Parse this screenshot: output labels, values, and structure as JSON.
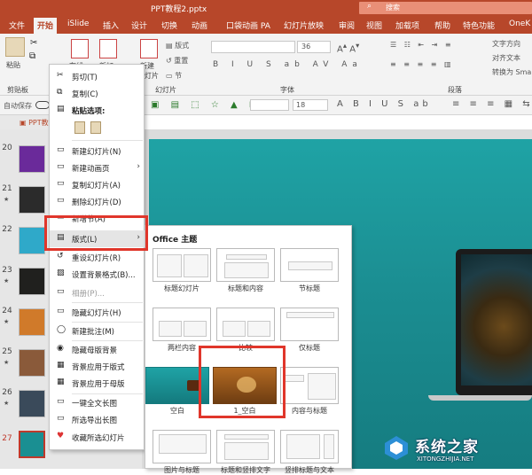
{
  "window": {
    "title": "PPT教程2.pptx",
    "search_placeholder": "搜索"
  },
  "tabs": [
    "开始",
    "iSlide",
    "插入",
    "设计",
    "切换",
    "动画",
    "口袋动画 PA",
    "幻灯片放映",
    "审阅",
    "视图",
    "加载项",
    "帮助",
    "特色功能",
    "OneK"
  ],
  "active_tab": "开始",
  "ribbon": {
    "paste": "粘贴",
    "new_slide_partial": "在线",
    "new_partial": "新加",
    "new_slide": "新建",
    "new_slide2": "幻灯片",
    "layout_btn": "版式",
    "reset_btn": "重置",
    "section_btn": "节",
    "clipboard_group": "剪贴板",
    "slides_group": "幻灯片",
    "font_group": "字体",
    "paragraph_group": "段落",
    "font_size": "36",
    "text_direction": "文字方向",
    "align_text": "对齐文本",
    "convert_smartart": "转换为 SmartArt",
    "font_size2": "18"
  },
  "qat": {
    "autosave": "自动保存"
  },
  "doc_tab": "PPT教程",
  "slides": [
    {
      "num": "20",
      "starred": false,
      "color": "#6a2a9a"
    },
    {
      "num": "21",
      "starred": true,
      "color": "#2b2b2b"
    },
    {
      "num": "22",
      "starred": false,
      "color": "#2fa9c9"
    },
    {
      "num": "23",
      "starred": true,
      "color": "#20201e"
    },
    {
      "num": "24",
      "starred": true,
      "color": "#d07a2a"
    },
    {
      "num": "25",
      "starred": true,
      "color": "#8a5a3a"
    },
    {
      "num": "26",
      "starred": true,
      "color": "#3a4a5a"
    },
    {
      "num": "27",
      "starred": false,
      "color": "#1a8f92"
    }
  ],
  "context_menu": {
    "cut": "剪切(T)",
    "copy": "复制(C)",
    "paste_options": "粘贴选项:",
    "new_slide": "新建幻灯片(N)",
    "new_anim_page": "新建动画页",
    "duplicate_slide": "复制幻灯片(A)",
    "delete_slide": "删除幻灯片(D)",
    "add_section": "新增节(A)",
    "layout": "版式(L)",
    "reset_slide": "重设幻灯片(R)",
    "format_background": "设置背景格式(B)...",
    "photo_album": "相册(P)...",
    "hide_slide": "隐藏幻灯片(H)",
    "new_comment": "新建批注(M)",
    "hide_master_bg": "隐藏母版背景",
    "apply_bg_layout": "背景应用于版式",
    "apply_bg_master": "背景应用于母版",
    "long_image": "一键全文长图",
    "export_selected_long_image": "所选导出长图",
    "collect_slide": "收藏所选幻灯片"
  },
  "layout_menu": {
    "header": "Office 主题",
    "layouts": [
      "标题幻灯片",
      "标题和内容",
      "节标题",
      "两栏内容",
      "比较",
      "仅标题",
      "空白",
      "1_空白",
      "内容与标题",
      "图片与标题",
      "标题和竖排文字",
      "竖排标题与文本"
    ]
  },
  "watermark": {
    "title": "系统之家",
    "url": "XITONGZHIJIA.NET"
  },
  "colors": {
    "accent": "#b7472a",
    "highlight_red": "#e0362b",
    "slide_teal": "#1fa3a5"
  }
}
